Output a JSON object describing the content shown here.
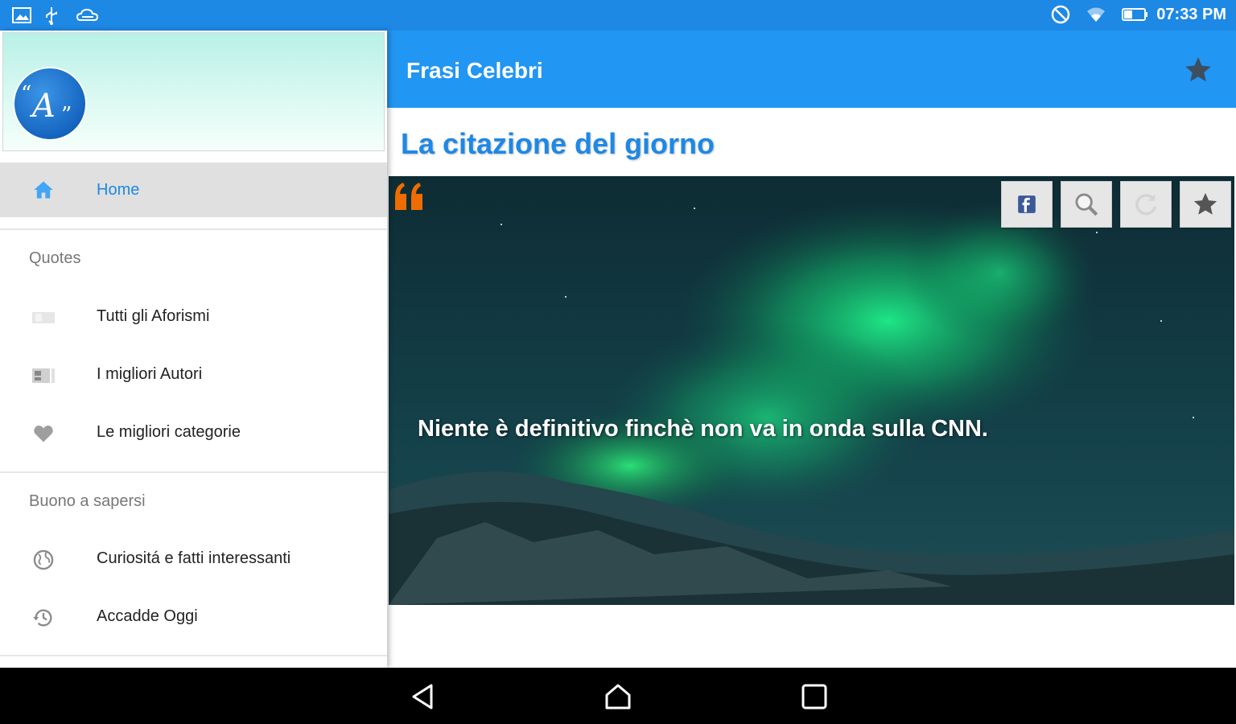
{
  "status_bar": {
    "time": "07:33 PM",
    "left_icons": [
      "image-icon",
      "usb-icon",
      "cloud-icon"
    ],
    "right_icons": [
      "do-not-disturb-icon",
      "wifi-icon",
      "battery-icon"
    ]
  },
  "app_bar": {
    "title": "Frasi Celebri",
    "action_icon": "star-icon",
    "color": "#2196f3"
  },
  "drawer": {
    "logo_text": "A",
    "home_label": "Home",
    "sections": [
      {
        "header": "Quotes",
        "items": [
          {
            "label": "Tutti gli Aforismi",
            "icon": "list-icon"
          },
          {
            "label": "I migliori Autori",
            "icon": "contacts-icon"
          },
          {
            "label": "Le migliori categorie",
            "icon": "heart-icon"
          }
        ]
      },
      {
        "header": "Buono a sapersi",
        "items": [
          {
            "label": "Curiositá e fatti interessanti",
            "icon": "globe-icon"
          },
          {
            "label": "Accadde Oggi",
            "icon": "history-icon"
          }
        ]
      }
    ]
  },
  "main": {
    "section_title": "La citazione del giorno",
    "quote": {
      "text": "Niente è definitivo finchè non va in onda sulla CNN.",
      "actions": [
        "facebook-icon",
        "search-icon",
        "refresh-icon",
        "star-icon"
      ],
      "quote_mark_color": "#ef6c00"
    }
  },
  "nav_bar": {
    "buttons": [
      "back-icon",
      "home-icon",
      "recents-icon"
    ]
  }
}
